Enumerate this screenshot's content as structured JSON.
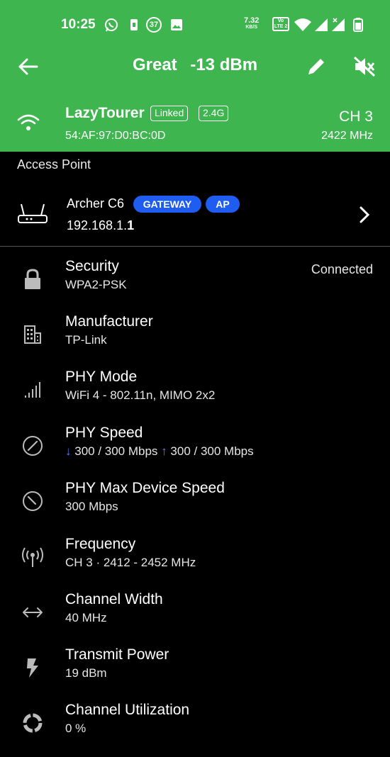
{
  "status_bar": {
    "time": "10:25",
    "notification_badge": "37",
    "net_speed": "7.32",
    "net_speed_unit": "KB/S",
    "lte_label": "Vo LTE 2"
  },
  "toolbar": {
    "quality": "Great",
    "signal": "-13 dBm"
  },
  "network": {
    "ssid": "LazyTourer",
    "badge_linked": "Linked",
    "badge_band": "2.4G",
    "mac": "54:AF:97:D0:BC:0D",
    "channel": "CH 3",
    "frequency": "2422 MHz"
  },
  "section_label": "Access Point",
  "access_point": {
    "name": "Archer C6",
    "badge_gateway": "GATEWAY",
    "badge_ap": "AP",
    "ip_prefix": "192.168.1.",
    "ip_last": "1"
  },
  "details": {
    "security": {
      "title": "Security",
      "value": "WPA2-PSK",
      "status": "Connected"
    },
    "manufacturer": {
      "title": "Manufacturer",
      "value": "TP-Link"
    },
    "phy_mode": {
      "title": "PHY Mode",
      "value": "WiFi 4 - 802.11n, MIMO 2x2"
    },
    "phy_speed": {
      "title": "PHY Speed",
      "down": "300 / 300 Mbps",
      "up": "300 / 300 Mbps"
    },
    "phy_max": {
      "title": "PHY Max Device Speed",
      "value": "300 Mbps"
    },
    "frequency": {
      "title": "Frequency",
      "value": "CH 3 · 2412 - 2452 MHz"
    },
    "channel_width": {
      "title": "Channel Width",
      "value": "40 MHz"
    },
    "transmit_power": {
      "title": "Transmit Power",
      "value": "19 dBm"
    },
    "channel_utilization": {
      "title": "Channel Utilization",
      "value": "0 %"
    }
  },
  "colors": {
    "header_green": "#3fb54f",
    "pill_blue": "#1f5cf0",
    "arrow_down": "#4d7cff",
    "arrow_up": "#9c5cff"
  }
}
